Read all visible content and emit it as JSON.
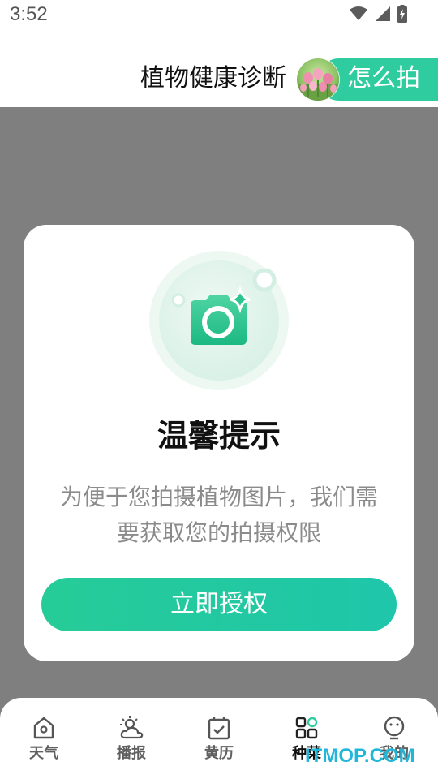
{
  "status_bar": {
    "time": "3:52",
    "icons": [
      "wifi-icon",
      "signal-icon",
      "battery-charging-icon"
    ]
  },
  "header": {
    "title": "植物健康诊断",
    "thumbnail": "flower-photo-thumbnail",
    "pill_label": "怎么拍",
    "pill_color": "#2fcc9f"
  },
  "dialog": {
    "icon": "camera-sparkle-icon",
    "title": "温馨提示",
    "message_line1": "为便于您拍摄植物图片，我们需",
    "message_line2": "要获取您的拍摄权限",
    "button_label": "立即授权",
    "accent_color": "#22c9a0"
  },
  "tabbar": {
    "tabs": [
      {
        "label": "天气",
        "icon": "home-icon",
        "active": false
      },
      {
        "label": "播报",
        "icon": "partly-cloudy-icon",
        "active": false
      },
      {
        "label": "黄历",
        "icon": "calendar-check-icon",
        "active": false
      },
      {
        "label": "种菜",
        "icon": "grid-apps-icon",
        "active": true
      },
      {
        "label": "我的",
        "icon": "profile-face-icon",
        "active": false
      }
    ]
  },
  "watermark": "ITMOP.COM"
}
